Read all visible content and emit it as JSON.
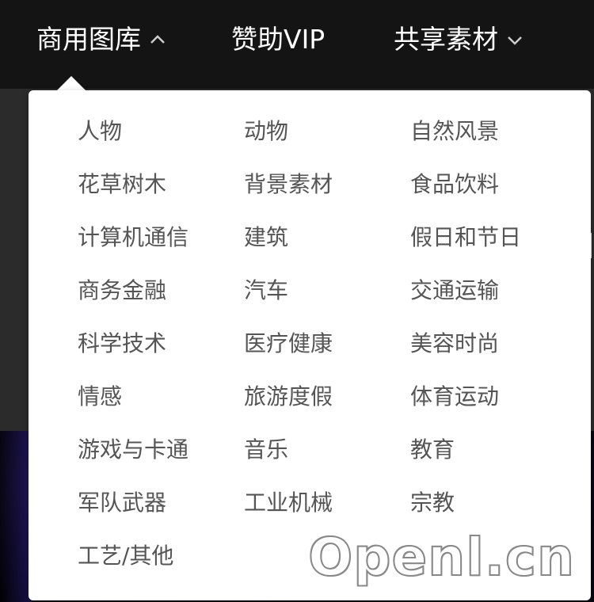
{
  "nav": {
    "items": [
      {
        "label": "商用图库",
        "icon": "chevron-up-icon"
      },
      {
        "label": "赞助VIP"
      },
      {
        "label": "共享素材",
        "icon": "chevron-down-icon"
      }
    ]
  },
  "dropdown": {
    "categories": [
      "人物",
      "动物",
      "自然风景",
      "花草树木",
      "背景素材",
      "食品饮料",
      "计算机通信",
      "建筑",
      "假日和节日",
      "商务金融",
      "汽车",
      "交通运输",
      "科学技术",
      "医疗健康",
      "美容时尚",
      "情感",
      "旅游度假",
      "体育运动",
      "游戏与卡通",
      "音乐",
      "教育",
      "军队武器",
      "工业机械",
      "宗教",
      "工艺/其他"
    ]
  },
  "watermark": "Openl.cn"
}
